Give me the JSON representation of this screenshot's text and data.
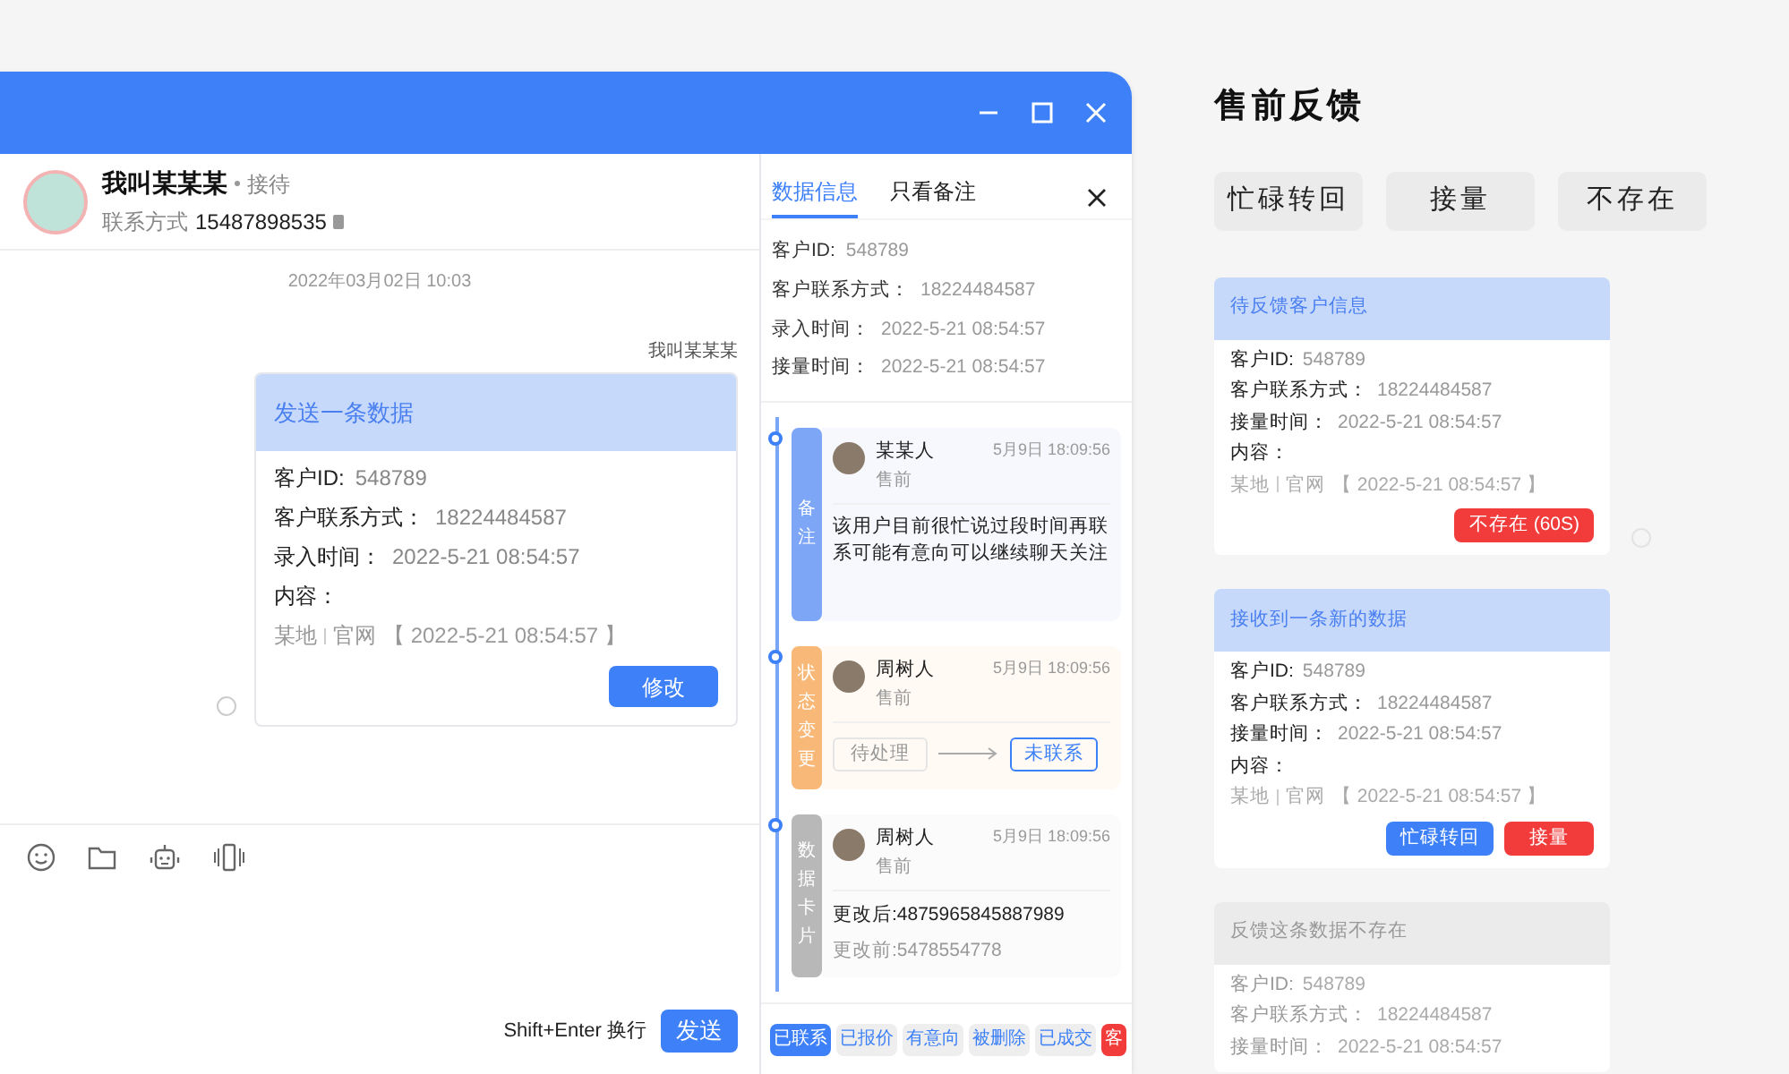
{
  "chat": {
    "contact": {
      "name": "我叫某某某",
      "status": "接待",
      "contact_label": "联系方式",
      "phone": "15487898535"
    },
    "date": "2022年03月02日  10:03",
    "message": {
      "sender": "我叫某某某",
      "title": "发送一条数据",
      "fields": [
        {
          "label": "客户ID:",
          "value": "548789"
        },
        {
          "label": "客户联系方式：",
          "value": "18224484587"
        },
        {
          "label": "录入时间：",
          "value": "2022-5-21  08:54:57"
        }
      ],
      "content_label": "内容：",
      "content": {
        "source": "某地",
        "channel": "官网",
        "stamp": "【 2022-5-21  08:54:57 】"
      },
      "button": "修改",
      "read": false
    },
    "hint": "Shift+Enter 换行",
    "send_button": "发送"
  },
  "panel": {
    "tabs": [
      {
        "label": "数据信息",
        "selected": true
      },
      {
        "label": "只看备注",
        "selected": false
      }
    ],
    "fields": [
      {
        "label": "客户ID:",
        "value": "548789"
      },
      {
        "label": "客户联系方式：",
        "value": "18224484587"
      },
      {
        "label": "录入时间：",
        "value": "2022-5-21  08:54:57"
      },
      {
        "label": "接量时间：",
        "value": "2022-5-21  08:54:57"
      }
    ],
    "timeline": [
      {
        "kind": "note",
        "tag": "备注",
        "author": "某某人",
        "role": "售前",
        "time": "5月9日 18:09:56",
        "text": "该用户目前很忙说过段时间再联系可能有意向可以继续聊天关注"
      },
      {
        "kind": "status",
        "tag": "状态变更",
        "author": "周树人",
        "role": "售前",
        "time": "5月9日 18:09:56",
        "from": "待处理",
        "to": "未联系"
      },
      {
        "kind": "card",
        "tag": "数据卡片",
        "author": "周树人",
        "role": "售前",
        "time": "5月9日 18:09:56",
        "after": "更改后:4875965845887989",
        "before": "更改前:5478554778"
      }
    ],
    "quick_tags": [
      {
        "label": "已联系",
        "selected": true,
        "kind": "normal"
      },
      {
        "label": "已报价",
        "selected": false,
        "kind": "normal"
      },
      {
        "label": "有意向",
        "selected": false,
        "kind": "normal"
      },
      {
        "label": "被删除",
        "selected": false,
        "kind": "normal"
      },
      {
        "label": "已成交",
        "selected": false,
        "kind": "normal"
      },
      {
        "label": "客",
        "selected": false,
        "kind": "danger"
      }
    ]
  },
  "feedback": {
    "title": "售前反馈",
    "actions": [
      "忙碌转回",
      "接量",
      "不存在"
    ],
    "cards": [
      {
        "kind": "pending",
        "title": "待反馈客户信息",
        "fields": [
          {
            "label": "客户ID:",
            "value": "548789"
          },
          {
            "label": "客户联系方式：",
            "value": "18224484587"
          },
          {
            "label": "接量时间：",
            "value": "2022-5-21  08:54:57"
          }
        ],
        "content_label": "内容：",
        "content": {
          "source": "某地",
          "channel": "官网",
          "stamp": "【 2022-5-21  08:54:57 】"
        },
        "buttons": [
          {
            "label": "不存在 (60S)",
            "kind": "red"
          }
        ],
        "read": false
      },
      {
        "kind": "new",
        "title": "接收到一条新的数据",
        "fields": [
          {
            "label": "客户ID:",
            "value": "548789"
          },
          {
            "label": "客户联系方式：",
            "value": "18224484587"
          },
          {
            "label": "接量时间：",
            "value": "2022-5-21  08:54:57"
          }
        ],
        "content_label": "内容：",
        "content": {
          "source": "某地",
          "channel": "官网",
          "stamp": "【 2022-5-21  08:54:57 】"
        },
        "buttons": [
          {
            "label": "忙碌转回",
            "kind": "blue"
          },
          {
            "label": "接量",
            "kind": "red"
          }
        ]
      },
      {
        "kind": "done",
        "title": "反馈这条数据不存在",
        "fields": [
          {
            "label": "客户ID:",
            "value": "548789"
          },
          {
            "label": "客户联系方式：",
            "value": "18224484587"
          },
          {
            "label": "接量时间：",
            "value": "2022-5-21  08:54:57"
          }
        ]
      }
    ]
  }
}
